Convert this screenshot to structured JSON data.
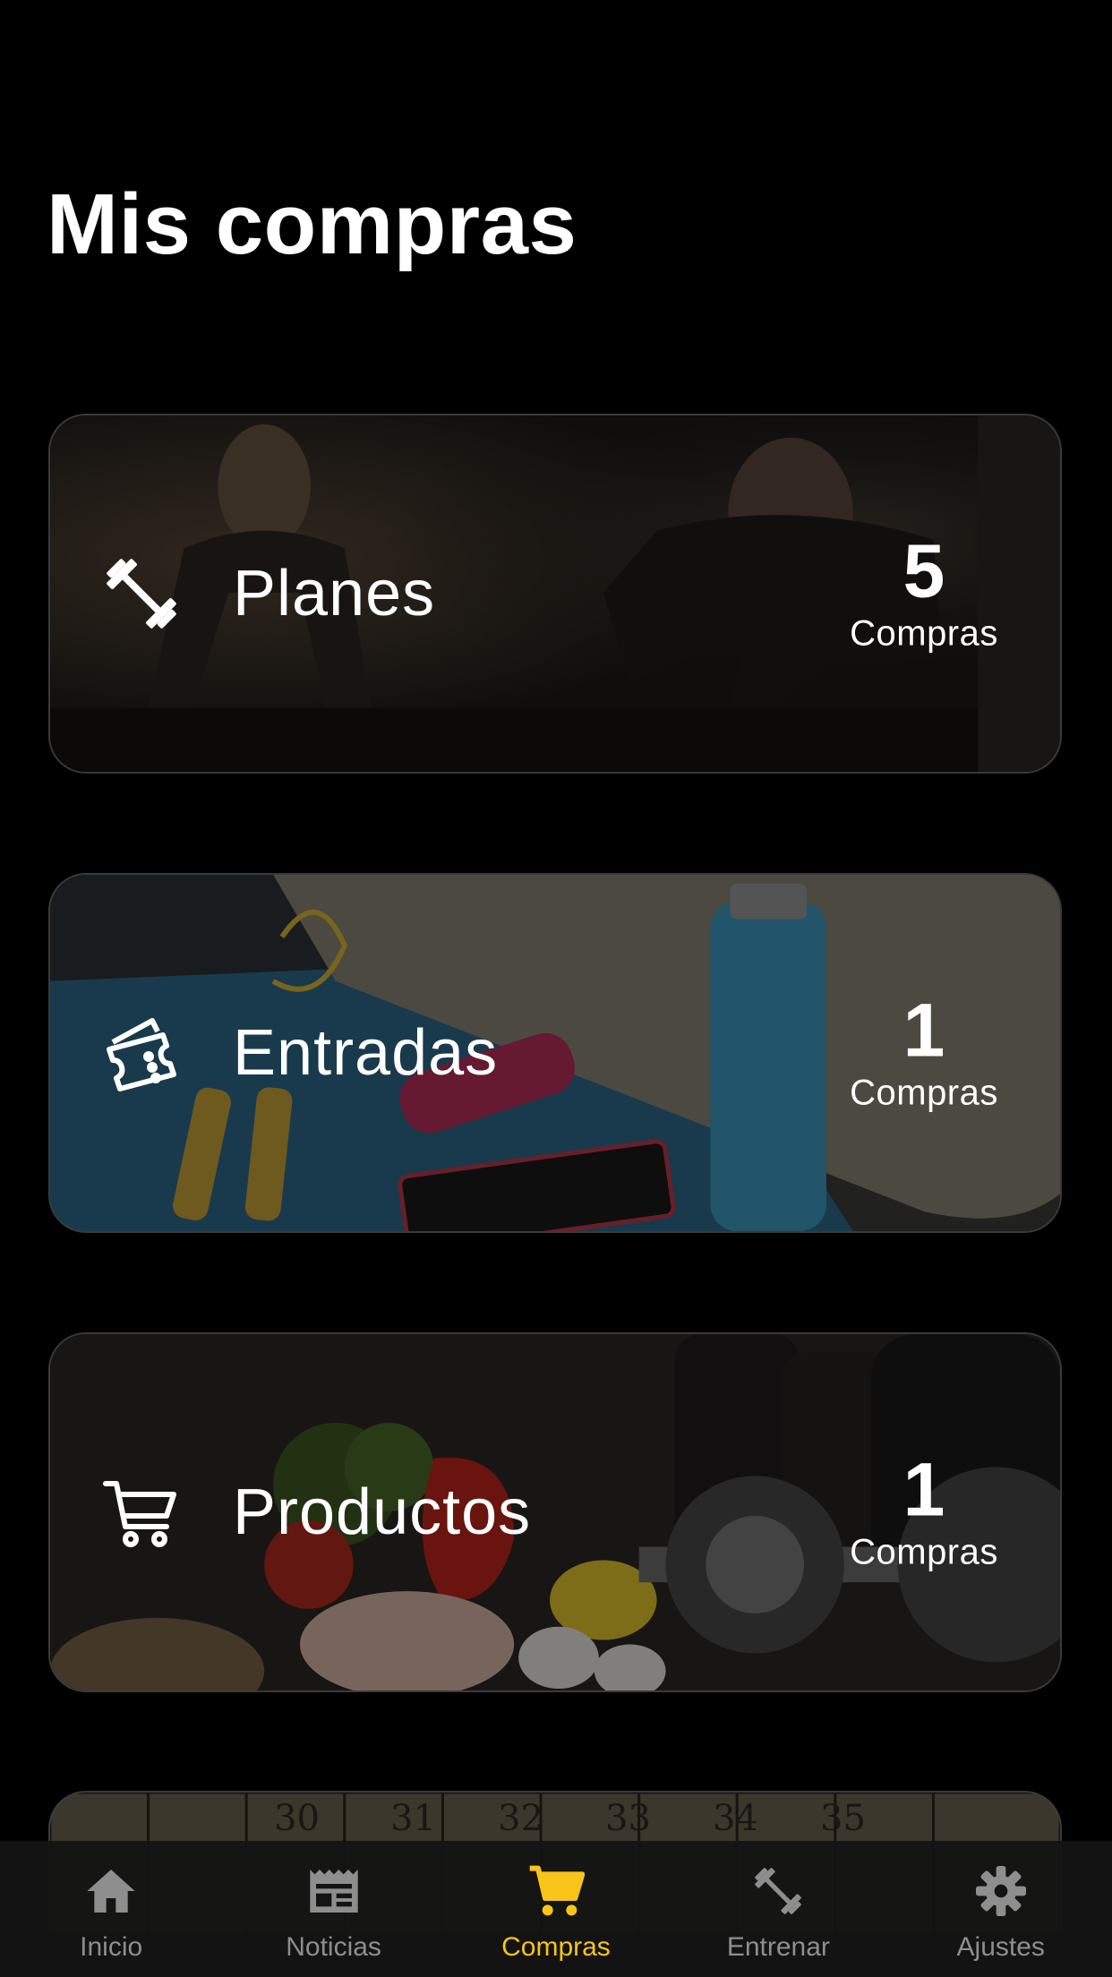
{
  "page": {
    "title": "Mis compras"
  },
  "cards": [
    {
      "label": "Planes",
      "count": "5",
      "count_label": "Compras",
      "icon": "dumbbell-icon",
      "image": "workout-photo"
    },
    {
      "label": "Entradas",
      "count": "1",
      "count_label": "Compras",
      "icon": "ticket-icon",
      "image": "fitness-gear-photo"
    },
    {
      "label": "Productos",
      "count": "1",
      "count_label": "Compras",
      "icon": "cart-icon",
      "image": "nutrition-photo"
    }
  ],
  "partial_card": {
    "image": "lockers-photo",
    "locker_numbers": [
      "30",
      "31",
      "32",
      "33",
      "34",
      "35"
    ]
  },
  "tab_bar": {
    "active_color": "#f7c417",
    "inactive_color": "#8e8e8e",
    "tabs": [
      {
        "label": "Inicio",
        "icon": "home-icon"
      },
      {
        "label": "Noticias",
        "icon": "newspaper-icon"
      },
      {
        "label": "Compras",
        "icon": "cart-icon",
        "active": true
      },
      {
        "label": "Entrenar",
        "icon": "dumbbell-icon"
      },
      {
        "label": "Ajustes",
        "icon": "gear-icon"
      }
    ]
  }
}
